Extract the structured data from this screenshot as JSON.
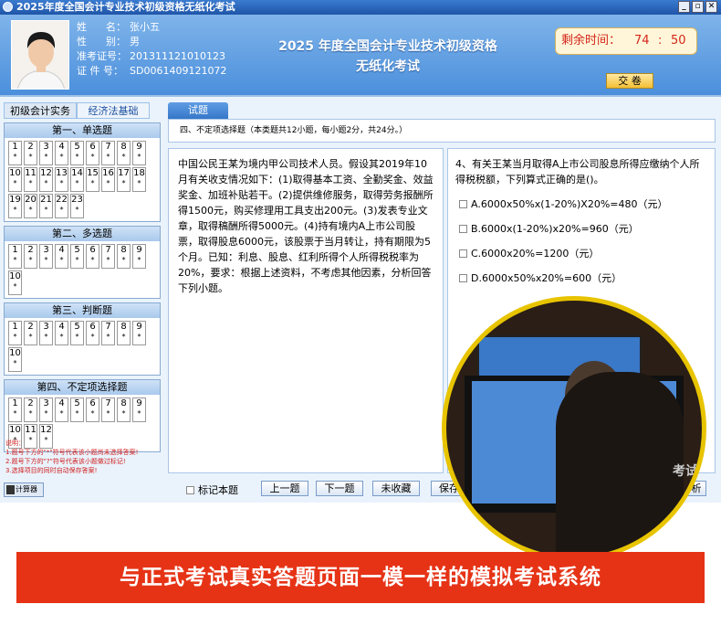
{
  "window": {
    "title": "2025年度全国会计专业技术初级资格无纸化考试"
  },
  "candidate": {
    "name_label": "姓      名：",
    "name": "张小五",
    "gender_label": "性      别：",
    "gender": "男",
    "ticket_label": "准考证号：",
    "ticket": "201311121010123",
    "id_label": "证 件 号：",
    "id": "SD0061409121072"
  },
  "exam": {
    "title_line1": "2025 年度全国会计专业技术初级资格",
    "title_line2": "无纸化考试"
  },
  "timer": {
    "label": "剩余时间：",
    "minutes": "74",
    "seconds": "50"
  },
  "submit_label": "交  卷",
  "subjects": [
    {
      "label": "初级会计实务"
    },
    {
      "label": "经济法基础"
    }
  ],
  "sections": [
    {
      "title": "第一、单选题",
      "count": 23
    },
    {
      "title": "第二、多选题",
      "count": 10
    },
    {
      "title": "第三、判断题",
      "count": 10
    },
    {
      "title": "第四、不定项选择题",
      "count": 12
    }
  ],
  "legend": {
    "title": "说明：",
    "line1": "1.题号下方的\"*\"符号代表该小题尚未选择答案!",
    "line2": "2.题号下方的\"?\"符号代表该小题做过标记!",
    "line3": "3.选择项目的同时自动保存答案!"
  },
  "calc_label": "计算器",
  "question_tab": "试题",
  "question_type": "四、不定项选择题（本类题共12小题，每小题2分，共24分。）",
  "material": "中国公民王某为境内甲公司技术人员。假设其2019年10月有关收支情况如下：(1)取得基本工资、全勤奖金、效益奖金、加班补贴若干。(2)提供维修服务，取得劳务报酬所得1500元，购买修理用工具支出200元。(3)发表专业文章，取得稿酬所得5000元。(4)持有境内A上市公司股票，取得股息6000元，该股票于当月转让，持有期限为5个月。已知：利息、股息、红利所得个人所得税税率为20%，要求：根据上述资料，不考虑其他因素，分析回答下列小题。",
  "question": {
    "stem": "4、有关王某当月取得A上市公司股息所得应缴纳个人所得税税额，下列算式正确的是()。",
    "options": [
      "A.6000x50%x(1-20%)X20%=480（元）",
      "B.6000x(1-20%)x20%=960（元）",
      "C.6000x20%=1200（元）",
      "D.6000x50%x20%=600（元）"
    ]
  },
  "bottom": {
    "mark_label": "标记本题",
    "prev": "上一题",
    "next": "下一题",
    "unfav": "未收藏",
    "save": "保存",
    "analysis": "题解析"
  },
  "overlay_fragment": "考试",
  "banner": "与正式考试真实答题页面一模一样的模拟考试系统"
}
